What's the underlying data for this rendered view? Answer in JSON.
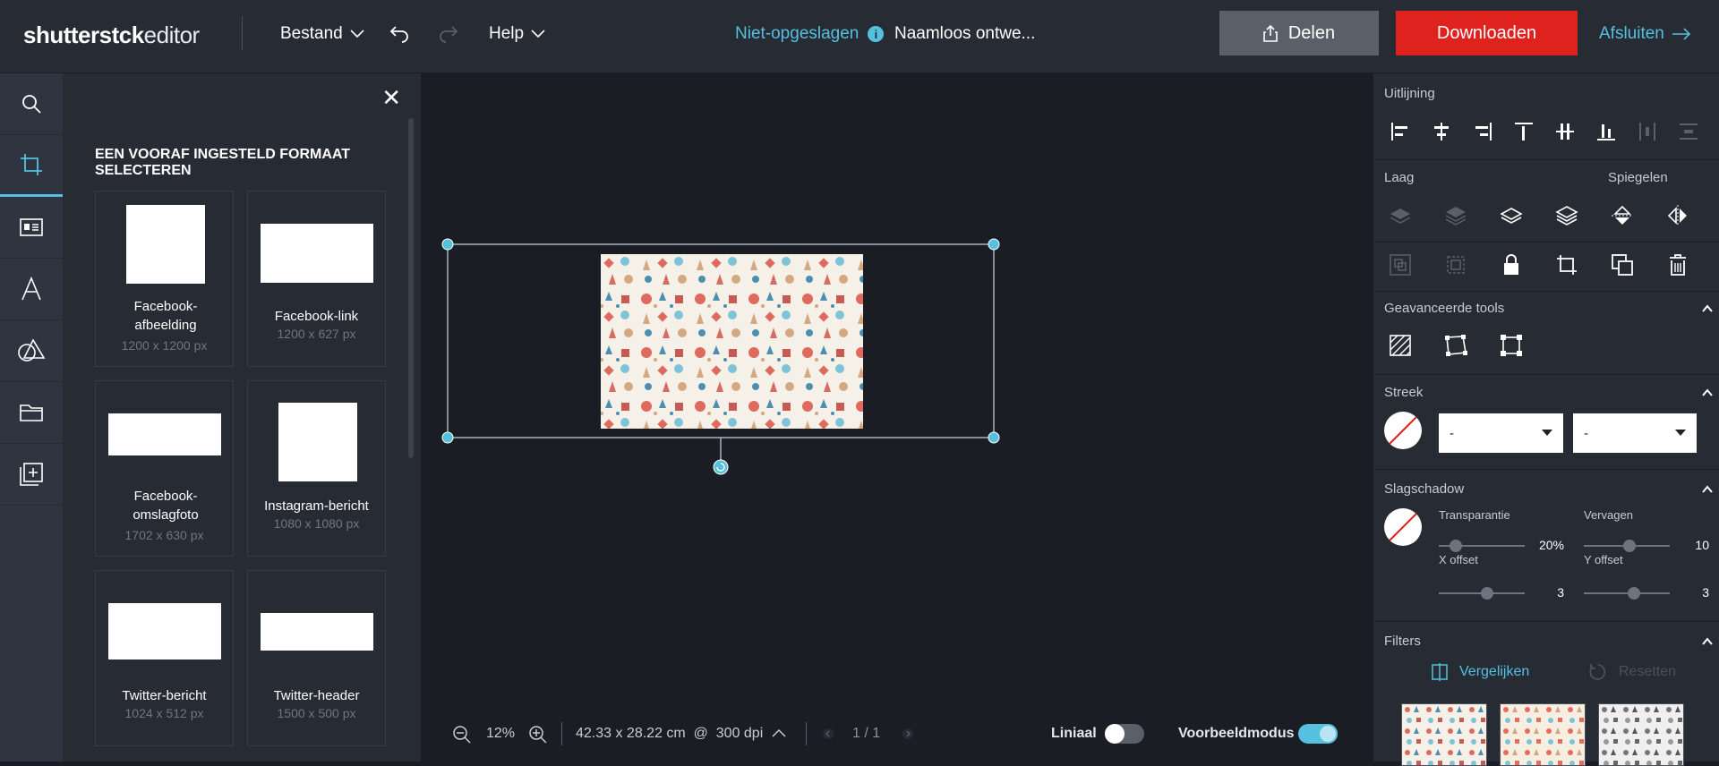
{
  "topbar": {
    "logo_bold": "shutterst",
    "logo_rest": "ck",
    "logo_suffix": "editor",
    "menu_file": "Bestand",
    "menu_help": "Help",
    "status": "Niet-opgeslagen",
    "status_info": "i",
    "doc_name": "Naamloos ontwe...",
    "share_label": "Delen",
    "download_label": "Downloaden",
    "exit_label": "Afsluiten"
  },
  "leftnav": {
    "items": [
      "search-icon",
      "crop-icon",
      "template-icon",
      "text-icon",
      "shapes-icon",
      "folder-icon",
      "add-page-icon"
    ],
    "active": "crop-icon"
  },
  "panel": {
    "title": "EEN VOORAF INGESTELD FORMAAT SELECTEREN",
    "presets": [
      {
        "name": "Facebook-afbeelding",
        "size": "1200 x 1200 px"
      },
      {
        "name": "Facebook-link",
        "size": "1200 x 627 px"
      },
      {
        "name": "Facebook-omslagfoto",
        "size": "1702 x 630 px"
      },
      {
        "name": "Instagram-bericht",
        "size": "1080 x 1080 px"
      },
      {
        "name": "Twitter-bericht",
        "size": "1024 x 512 px"
      },
      {
        "name": "Twitter-header",
        "size": "1500 x 500 px"
      }
    ]
  },
  "bottombar": {
    "zoom": "12%",
    "dimensions": "42.33 x 28.22 cm  @  300 dpi",
    "page": "1 / 1",
    "ruler_label": "Liniaal",
    "ruler_on": false,
    "preview_label": "Voorbeeldmodus",
    "preview_on": true
  },
  "right": {
    "alignment_label": "Uitlijning",
    "layer_label": "Laag",
    "mirror_label": "Spiegelen",
    "advanced_label": "Geavanceerde tools",
    "stroke_label": "Streek",
    "stroke_select1": "-",
    "stroke_select2": "-",
    "shadow_label": "Slagschadow",
    "transparency_label": "Transparantie",
    "transparency_value": "20%",
    "transparency_level": 0.2,
    "blur_label": "Vervagen",
    "blur_value": "10",
    "x_offset_label": "X offset",
    "x_offset_value": "3",
    "y_offset_label": "Y offset",
    "y_offset_value": "3",
    "filters_label": "Filters",
    "compare_label": "Vergelijken",
    "reset_label": "Resetten"
  },
  "colors": {
    "accent": "#56c1df",
    "download": "#e0221f",
    "share": "#5a606a"
  }
}
